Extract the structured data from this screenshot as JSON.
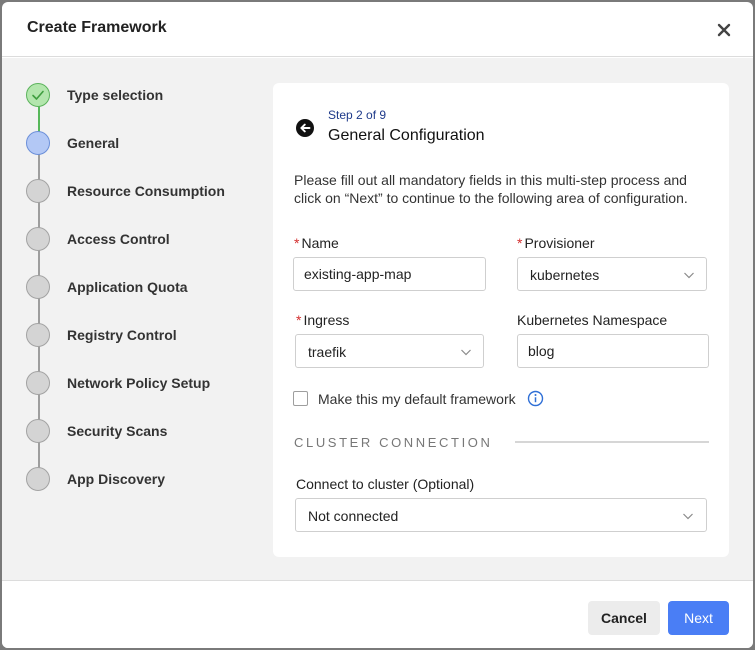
{
  "modal": {
    "title": "Create Framework"
  },
  "stepper": {
    "steps": [
      {
        "label": "Type selection",
        "state": "done"
      },
      {
        "label": "General",
        "state": "active"
      },
      {
        "label": "Resource Consumption",
        "state": "pending"
      },
      {
        "label": "Access Control",
        "state": "pending"
      },
      {
        "label": "Application Quota",
        "state": "pending"
      },
      {
        "label": "Registry Control",
        "state": "pending"
      },
      {
        "label": "Network Policy Setup",
        "state": "pending"
      },
      {
        "label": "Security Scans",
        "state": "pending"
      },
      {
        "label": "App Discovery",
        "state": "pending"
      }
    ]
  },
  "form": {
    "step_count": "Step 2 of 9",
    "title": "General Configuration",
    "description": "Please fill out all mandatory fields in this multi-step process and click on “Next” to continue to the following area of configuration.",
    "required_marker": "*",
    "name": {
      "label": "Name",
      "value": "existing-app-map"
    },
    "provisioner": {
      "label": "Provisioner",
      "value": "kubernetes"
    },
    "ingress": {
      "label": "Ingress",
      "value": "traefik"
    },
    "namespace": {
      "label": "Kubernetes Namespace",
      "value": "blog"
    },
    "default_checkbox": {
      "label": "Make this my default framework",
      "checked": false
    },
    "cluster_section": {
      "title": "CLUSTER CONNECTION"
    },
    "cluster": {
      "label": "Connect to cluster (Optional)",
      "value": "Not connected"
    }
  },
  "footer": {
    "cancel_label": "Cancel",
    "next_label": "Next"
  },
  "colors": {
    "accent": "#4a7ef5",
    "step_done": "#b3e6ad",
    "step_active": "#b3c8f5",
    "required": "#d32f2f",
    "info": "#2f6fd6"
  },
  "icons": [
    "close-icon",
    "check-icon",
    "back-arrow-icon",
    "chevron-down-icon",
    "info-icon"
  ]
}
